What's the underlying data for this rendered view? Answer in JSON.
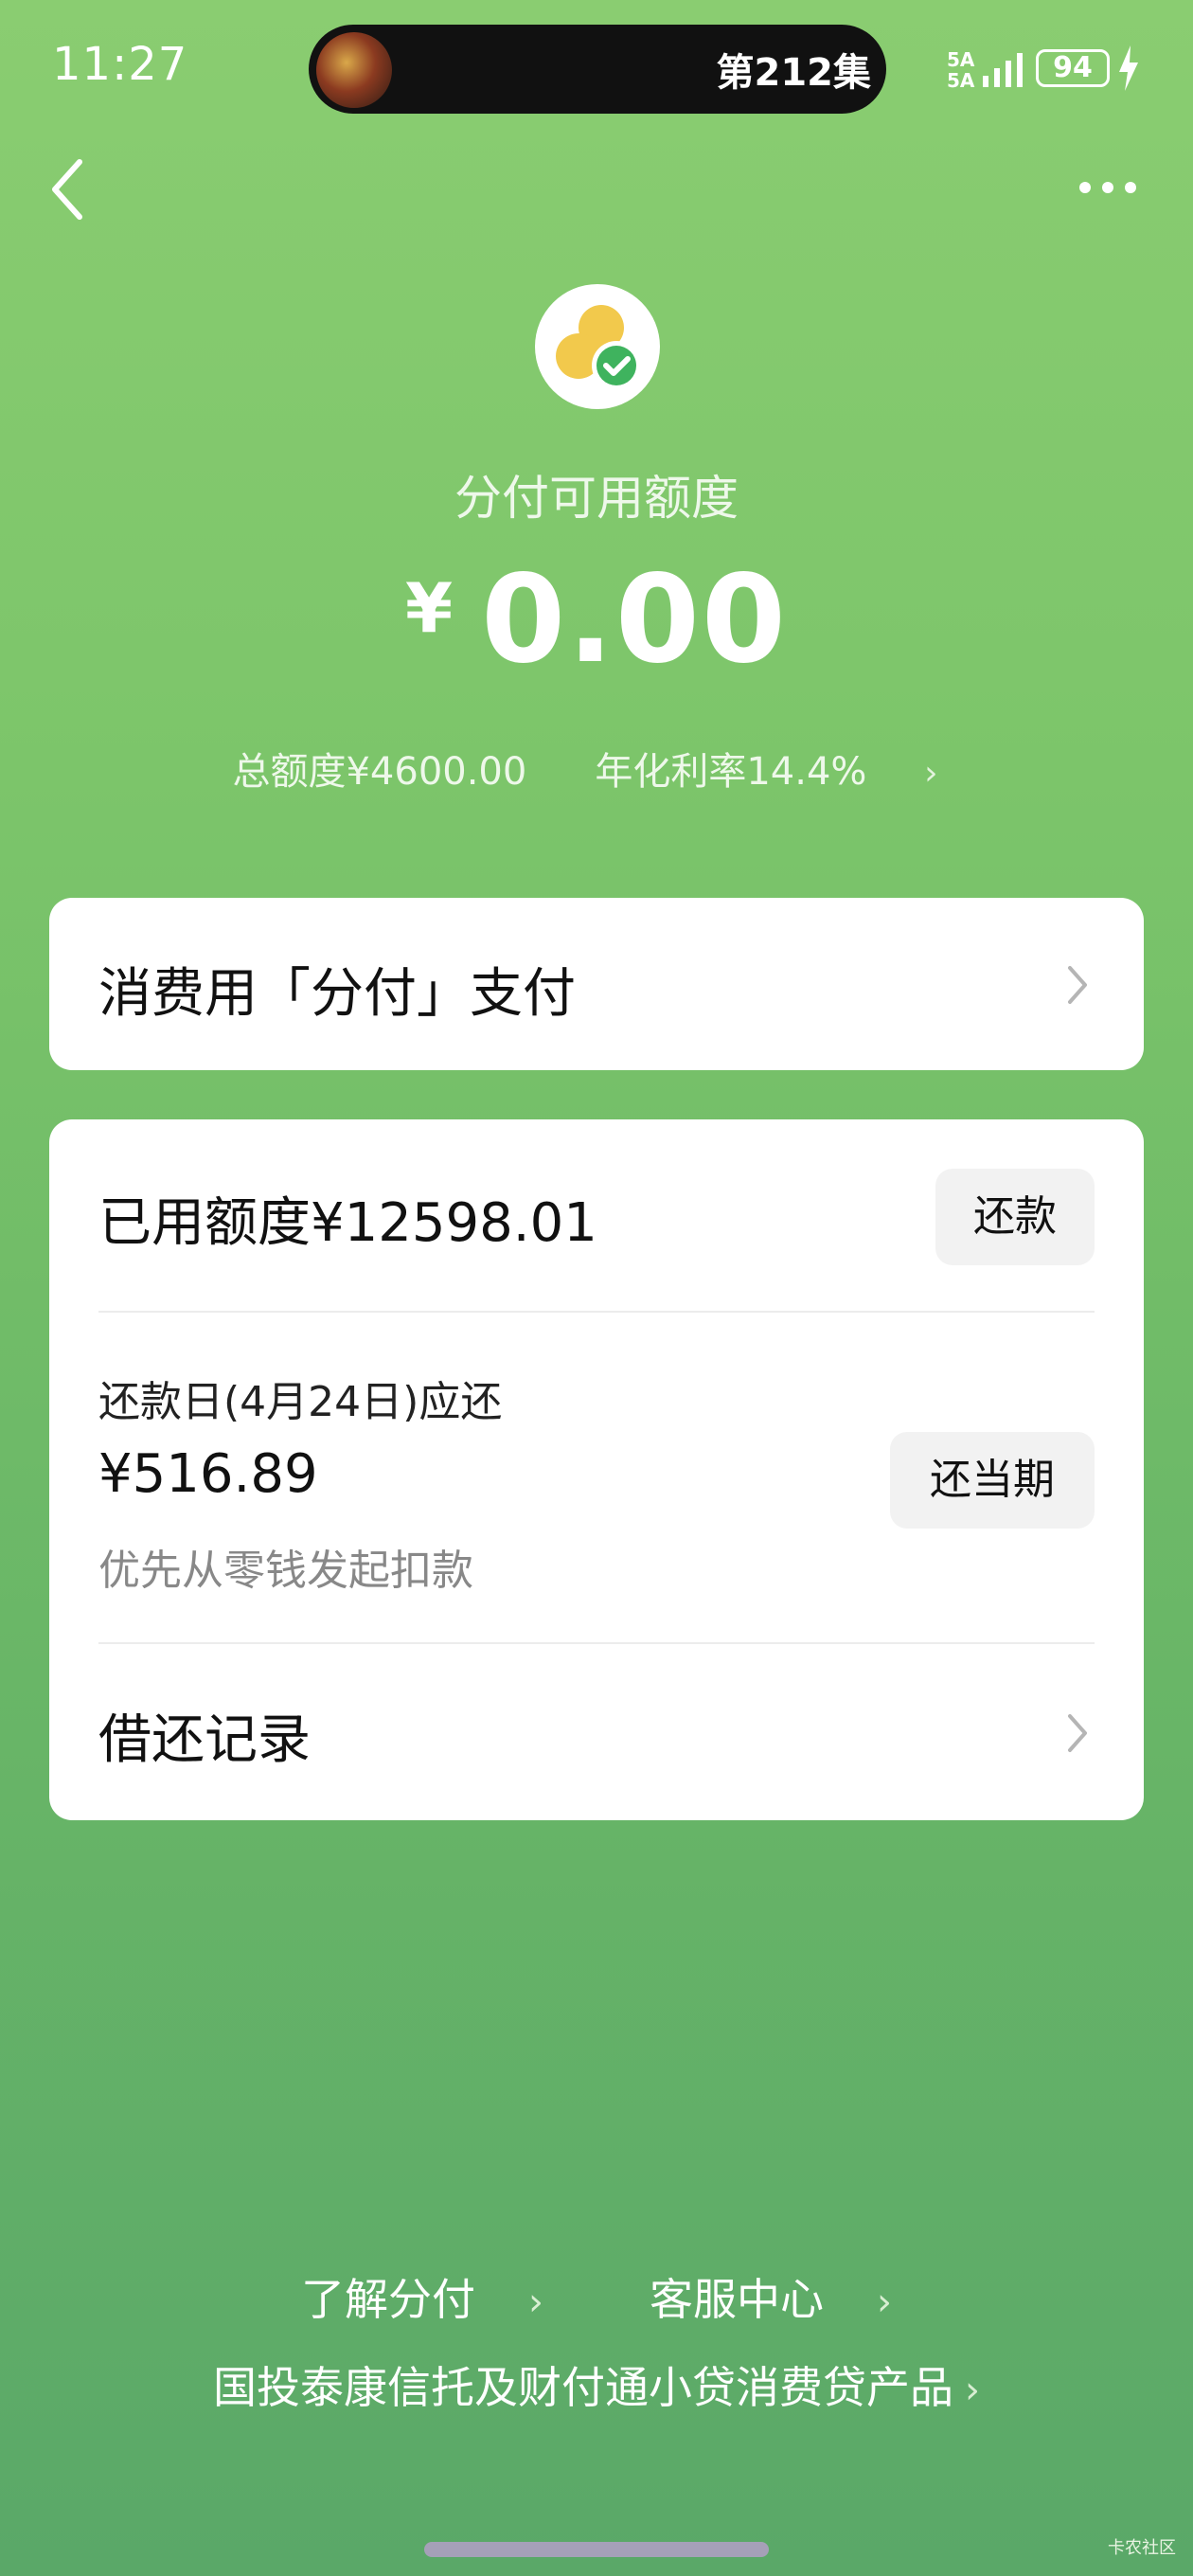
{
  "status_bar": {
    "time": "11:27",
    "live_activity_text": "第212集",
    "signal_top": "5A",
    "signal_bottom": "5A",
    "battery": "94"
  },
  "header": {
    "back_icon": "chevron-left-icon",
    "more_icon": "more-dots-icon"
  },
  "summary": {
    "logo_icon": "fenfu-logo-icon",
    "title": "分付可用额度",
    "currency": "¥",
    "available": "0.00",
    "total_quota": "总额度¥4600.00",
    "annual_rate": "年化利率14.4%"
  },
  "pay_card": {
    "label": "消费用「分付」支付"
  },
  "usage_card": {
    "used_label": "已用额度¥12598.01",
    "repay_button": "还款",
    "due_label": "还款日(4月24日)应还",
    "due_amount": "¥516.89",
    "deduct_note": "优先从零钱发起扣款",
    "repay_current_button": "还当期",
    "records_label": "借还记录"
  },
  "footer": {
    "learn_link": "了解分付",
    "service_link": "客服中心",
    "product_link": "国投泰康信托及财付通小贷消费贷产品"
  },
  "watermark": "卡农社区",
  "colors": {
    "bg_top": "#8acd71",
    "bg_bottom": "#5aa868",
    "card": "#ffffff",
    "button_bg": "#f2f2f2",
    "logo_yellow": "#f2c94c",
    "logo_green": "#3fb35e"
  }
}
